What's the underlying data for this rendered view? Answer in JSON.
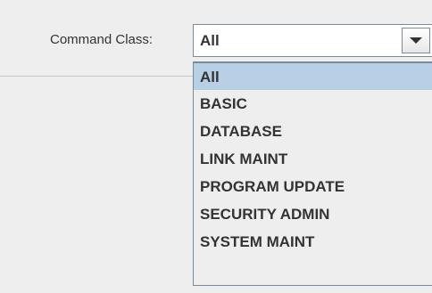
{
  "form": {
    "command_class_label": "Command Class:",
    "selected_value": "All"
  },
  "dropdown": {
    "options": [
      {
        "label": "All",
        "selected": true
      },
      {
        "label": "BASIC",
        "selected": false
      },
      {
        "label": "DATABASE",
        "selected": false
      },
      {
        "label": "LINK MAINT",
        "selected": false
      },
      {
        "label": "PROGRAM UPDATE",
        "selected": false
      },
      {
        "label": "SECURITY ADMIN",
        "selected": false
      },
      {
        "label": "SYSTEM MAINT",
        "selected": false
      }
    ]
  },
  "colors": {
    "background": "#eeeeee",
    "field_border": "#7a8a99",
    "selection_background": "#b8cfe5",
    "text": "#333333"
  },
  "icons": {
    "dropdown_arrow": "chevron-down-icon"
  }
}
